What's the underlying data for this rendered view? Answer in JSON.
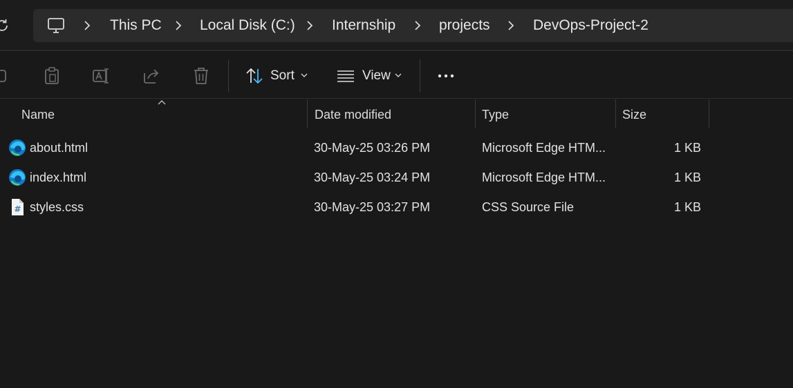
{
  "breadcrumb": {
    "items": [
      {
        "label": "This PC"
      },
      {
        "label": "Local Disk (C:)"
      },
      {
        "label": "Internship"
      },
      {
        "label": "projects"
      },
      {
        "label": "DevOps-Project-2"
      }
    ]
  },
  "toolbar": {
    "sort_label": "Sort",
    "view_label": "View"
  },
  "columns": {
    "name": "Name",
    "date": "Date modified",
    "type": "Type",
    "size": "Size"
  },
  "files": [
    {
      "name": "about.html",
      "date": "30-May-25 03:26 PM",
      "type": "Microsoft Edge HTM...",
      "size": "1 KB",
      "icon": "edge-html-icon"
    },
    {
      "name": "index.html",
      "date": "30-May-25 03:24 PM",
      "type": "Microsoft Edge HTM...",
      "size": "1 KB",
      "icon": "edge-html-icon"
    },
    {
      "name": "styles.css",
      "date": "30-May-25 03:27 PM",
      "type": "CSS Source File",
      "size": "1 KB",
      "icon": "css-file-icon"
    }
  ],
  "colors": {
    "background": "#191919",
    "address_bar": "#2b2b2b",
    "accent": "#1e8fd8"
  }
}
